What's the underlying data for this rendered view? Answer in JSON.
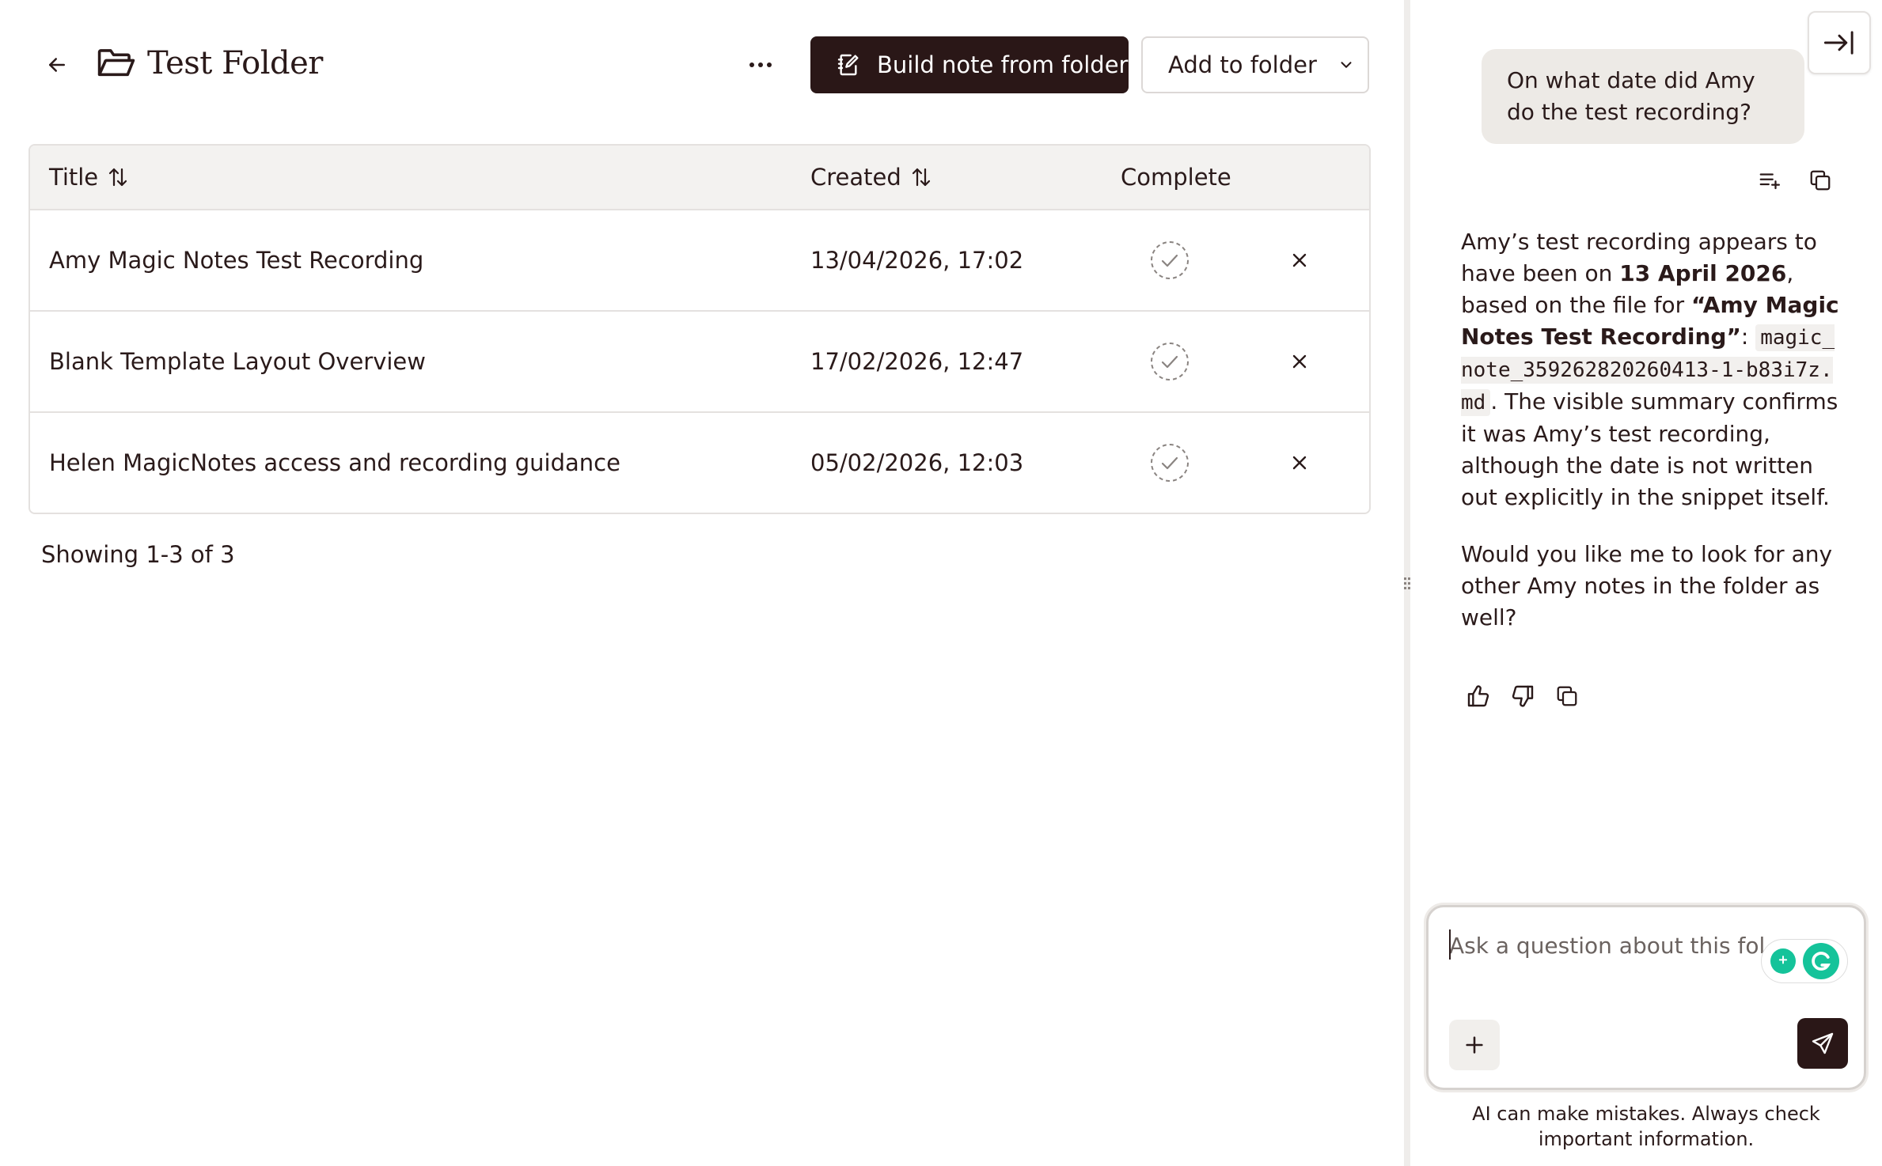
{
  "header": {
    "title": "Test Folder",
    "build_label": "Build note from folder",
    "add_label": "Add to folder"
  },
  "table": {
    "columns": {
      "title": "Title",
      "created": "Created",
      "complete": "Complete"
    },
    "rows": [
      {
        "title": "Amy Magic Notes Test Recording",
        "created": "13/04/2026, 17:02"
      },
      {
        "title": "Blank Template Layout Overview",
        "created": "17/02/2026, 12:47"
      },
      {
        "title": "Helen MagicNotes access and recording guidance",
        "created": "05/02/2026, 12:03"
      }
    ],
    "showing": "Showing 1-3 of 3"
  },
  "chat": {
    "user_message": "On what date did Amy do the test recording?",
    "assistant": {
      "p1_a": "Amy’s test recording appears to have been on ",
      "p1_date": "13 April 2026",
      "p1_b": ", based on the file for ",
      "p1_file_title": "“Amy Magic Notes Test Recording”",
      "p1_c": ": ",
      "p1_code": "magic_note_359262820260413-1-b83i7z.md",
      "p1_d": ". The visible summary confirms it was Amy’s test recording, although the date is not written out explicitly in the snippet itself.",
      "p2": "Would you like me to look for any other Amy notes in the folder as well?"
    },
    "input_placeholder": "Ask a question about this folder",
    "disclaimer": "AI can make mistakes. Always check important information."
  },
  "icons": {
    "back": "arrow-left-icon",
    "folder": "folder-open-icon",
    "more": "ellipsis-icon",
    "build": "note-edit-icon",
    "chevron": "chevron-down-icon",
    "sort": "sort-arrows-icon",
    "complete": "dashed-check-circle-icon",
    "remove": "close-icon",
    "collapse": "collapse-right-icon",
    "add_to_note": "add-to-note-icon",
    "copy": "copy-icon",
    "thumbs_up": "thumbs-up-icon",
    "thumbs_down": "thumbs-down-icon",
    "plus": "plus-icon",
    "send": "send-icon",
    "grammarly": "grammarly-icon"
  },
  "colors": {
    "primary_dark": "#2a1717",
    "header_bg": "#f3f2f0",
    "user_bubble": "#edeae6",
    "grammarly_green": "#15c39a"
  }
}
